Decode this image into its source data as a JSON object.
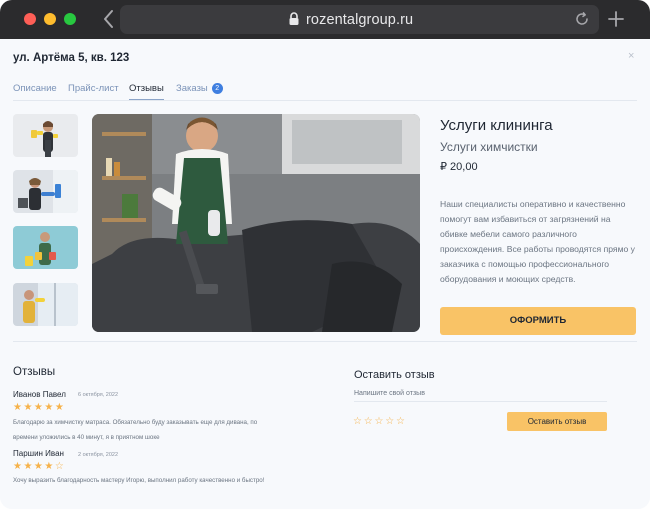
{
  "browser": {
    "url": "rozentalgroup.ru"
  },
  "page": {
    "address": "ул. Артёма 5, кв. 123",
    "close": "×",
    "tabs": [
      {
        "label": "Описание"
      },
      {
        "label": "Прайс-лист"
      },
      {
        "label": "Отзывы",
        "active": true
      },
      {
        "label": "Заказы",
        "badge": "2"
      }
    ]
  },
  "product": {
    "title": "Услуги клининга",
    "subtitle": "Услуги химчистки",
    "price": "₽ 20,00",
    "description": "Наши специалисты оперативно и качественно помогут вам избавиться от загрязнений на обивке мебели самого различного происхождения. Все работы проводятся прямо у заказчика с помощью профессионального оборудования и моющих средств.",
    "order_button": "ОФОРМИТЬ"
  },
  "reviews": {
    "heading": "Отзывы",
    "items": [
      {
        "name": "Иванов Павел",
        "date": "6 октября, 2022",
        "rating": 5,
        "stars": "★★★★★",
        "text": "Благодарю за химчистку матраса. Обязательно буду заказывать еще для дивана, по времени уложились в 40 минут, я в приятном шоке"
      },
      {
        "name": "Паршин Иван",
        "date": "2 октября, 2022",
        "rating": 4,
        "stars": "★★★★☆",
        "text": "Хочу выразить благодарность мастеру Игорю, выполнил работу качественно и быстро!"
      }
    ]
  },
  "leave_review": {
    "heading": "Оставить отзыв",
    "label": "Напишите свой отзыв",
    "stars": "☆☆☆☆☆",
    "button": "Оставить отзыв"
  },
  "colors": {
    "accent": "#f9c366",
    "star": "#f6b24a",
    "tab_link": "#7b93b8",
    "badge": "#3f7fe0"
  }
}
